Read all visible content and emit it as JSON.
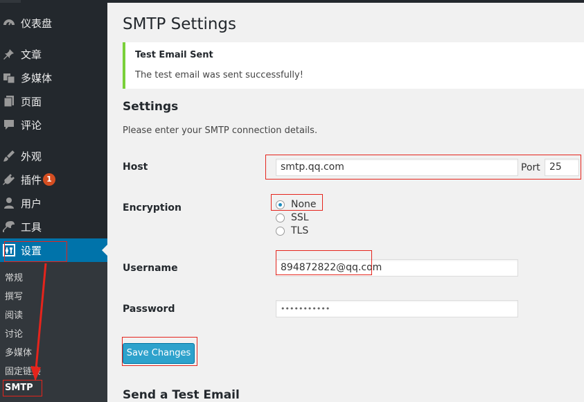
{
  "sidebar": {
    "items": [
      {
        "label": "仪表盘",
        "icon": "dashboard-icon"
      },
      {
        "label": "文章",
        "icon": "pin-icon"
      },
      {
        "label": "多媒体",
        "icon": "media-icon"
      },
      {
        "label": "页面",
        "icon": "page-icon"
      },
      {
        "label": "评论",
        "icon": "comment-icon"
      },
      {
        "label": "外观",
        "icon": "brush-icon"
      },
      {
        "label": "插件",
        "icon": "plugin-icon",
        "badge": "1"
      },
      {
        "label": "用户",
        "icon": "user-icon"
      },
      {
        "label": "工具",
        "icon": "wrench-icon"
      },
      {
        "label": "设置",
        "icon": "settings-icon"
      }
    ],
    "submenu": [
      "常规",
      "撰写",
      "阅读",
      "讨论",
      "多媒体",
      "固定链接",
      "SMTP"
    ]
  },
  "main": {
    "title": "SMTP Settings",
    "notice": {
      "title": "Test Email Sent",
      "message": "The test email was sent successfully!"
    },
    "settings_heading": "Settings",
    "settings_desc": "Please enter your SMTP connection details.",
    "host": {
      "label": "Host",
      "value": "smtp.qq.com",
      "port_label": "Port",
      "port_value": "25"
    },
    "encryption": {
      "label": "Encryption",
      "options": [
        "None",
        "SSL",
        "TLS"
      ],
      "selected": "None"
    },
    "username": {
      "label": "Username",
      "value": "894872822@qq.com"
    },
    "password": {
      "label": "Password",
      "value": "•••••••••••"
    },
    "save_label": "Save Changes",
    "test_heading": "Send a Test Email"
  },
  "colors": {
    "sidebar": "#23282d",
    "active": "#0073aa",
    "notice_border": "#7ad03a",
    "button": "#2ea2cc",
    "annotation": "#e5241c"
  }
}
